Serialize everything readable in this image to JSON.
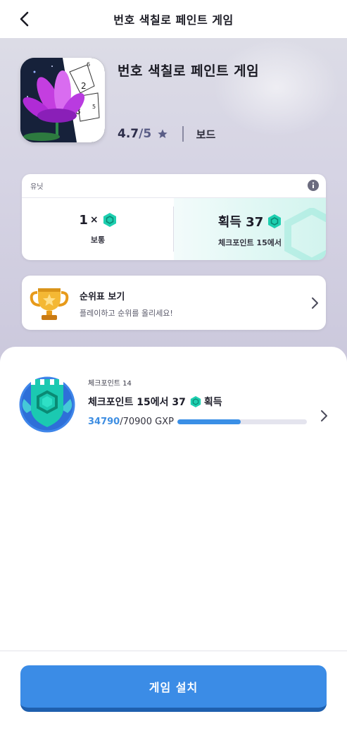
{
  "header": {
    "title": "번호 색칠로 페인트 게임"
  },
  "app": {
    "name": "번호 색칠로 페인트 게임",
    "rating": "4.7",
    "rating_max": "/5",
    "genre": "보드"
  },
  "unit_card": {
    "label": "유닛",
    "cost": {
      "value": "1",
      "multiplier": "×",
      "difficulty": "보통"
    },
    "reward": {
      "text": "획득 37",
      "note": "체크포인트 15에서"
    }
  },
  "leaderboard": {
    "title": "순위표 보기",
    "subtitle": "플레이하고 순위를 올리세요!"
  },
  "checkpoint": {
    "label": "체크포인트 14",
    "title_prefix": "체크포인트 15에서 37",
    "title_suffix": "획득",
    "xp_current": "34790",
    "xp_rest": "/70900 GXP",
    "progress": 0.49
  },
  "install_button": {
    "label": "게임 설치"
  },
  "colors": {
    "accent": "#3b8ce6",
    "gem": "#1ecfb0",
    "trophy": "#f0b429"
  }
}
